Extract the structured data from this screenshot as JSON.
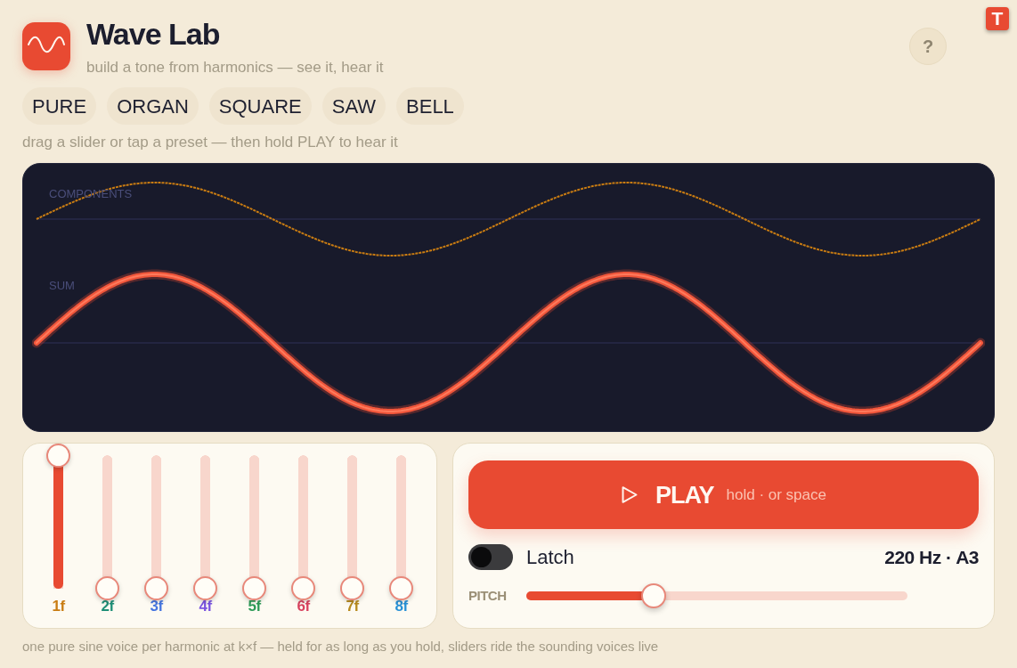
{
  "app": {
    "title": "Wave Lab",
    "subtitle": "build a tone from harmonics — see it, hear it",
    "help_button": "?"
  },
  "extension_badge": {
    "label": "T"
  },
  "presets": [
    {
      "label": "PURE",
      "selected": false
    },
    {
      "label": "ORGAN",
      "selected": false
    },
    {
      "label": "SQUARE",
      "selected": false
    },
    {
      "label": "SAW",
      "selected": false
    },
    {
      "label": "BELL",
      "selected": false
    }
  ],
  "hint": "drag a slider or tap a preset — then hold PLAY to hear it",
  "scope": {
    "components_label": "COMPONENTS",
    "sum_label": "SUM"
  },
  "harmonics": [
    {
      "label": "1f",
      "level": 1,
      "color": "#c97c12"
    },
    {
      "label": "2f",
      "level": 0,
      "color": "#1f8f77"
    },
    {
      "label": "3f",
      "level": 0,
      "color": "#4676e0"
    },
    {
      "label": "4f",
      "level": 0,
      "color": "#7a54e0"
    },
    {
      "label": "5f",
      "level": 0,
      "color": "#2e9b58"
    },
    {
      "label": "6f",
      "level": 0,
      "color": "#d8435f"
    },
    {
      "label": "7f",
      "level": 0,
      "color": "#b88b1f"
    },
    {
      "label": "8f",
      "level": 0,
      "color": "#2991d6"
    }
  ],
  "play": {
    "label": "PLAY",
    "hint": "hold · or space"
  },
  "latch": {
    "label": "Latch",
    "on": false
  },
  "frequency_readout": "220 Hz · A3",
  "pitch": {
    "label": "PITCH",
    "level": 0.334
  },
  "footer": "one pure sine voice per harmonic at k×f — held for as long as you hold, sliders ride the sounding voices live"
}
